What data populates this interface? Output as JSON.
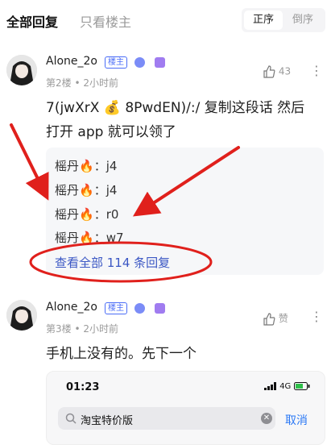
{
  "tabs": {
    "all_replies": "全部回复",
    "only_op": "只看楼主"
  },
  "sort": {
    "ascending": "正序",
    "descending": "倒序"
  },
  "comments": [
    {
      "username": "Alone_2o",
      "mod_badge": "楼主",
      "floor": "第2楼",
      "time": "2小时前",
      "likes": "43",
      "text_line1": "7(jwXrX 💰 8PwdEN)/:/ 复制这段话 然后",
      "text_line2": "打开 app 就可以领了",
      "replies": [
        {
          "name": "榣丹",
          "emoji": "🔥",
          "text": "j4"
        },
        {
          "name": "榣丹",
          "emoji": "🔥",
          "text": "j4"
        },
        {
          "name": "榣丹",
          "emoji": "🔥",
          "text": "r0"
        },
        {
          "name": "榣丹",
          "emoji": "🔥",
          "text": "w7"
        }
      ],
      "view_all": "查看全部 114 条回复"
    },
    {
      "username": "Alone_2o",
      "mod_badge": "楼主",
      "floor": "第3楼",
      "time": "2小时前",
      "likes": "赞",
      "text": "手机上没有的。先下一个",
      "embedded_screenshot": {
        "time": "01:23",
        "status": "4G",
        "search_text": "淘宝特价版",
        "cancel": "取消"
      }
    }
  ],
  "meta_separator": " • ",
  "colors": {
    "annotation_red": "#e0201c",
    "link_blue": "#3b57c4",
    "cancel_blue": "#2a78f5"
  }
}
